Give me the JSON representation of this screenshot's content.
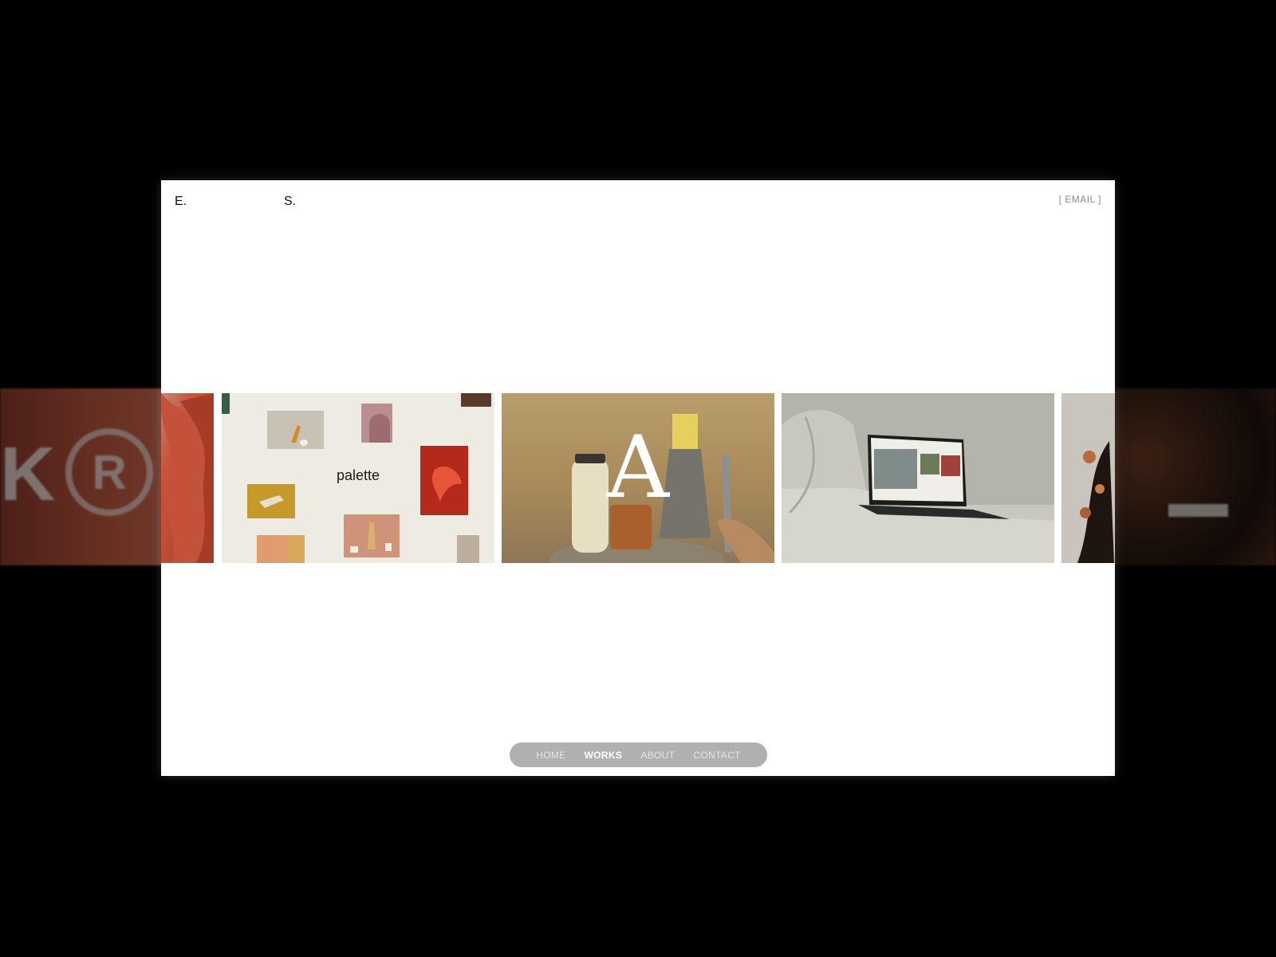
{
  "header": {
    "logo_first": "E.",
    "logo_last": "S.",
    "email_link": "[ EMAIL ]"
  },
  "background_bleed": {
    "left_text": "K",
    "left_symbol": "R"
  },
  "carousel": {
    "cards": [
      {
        "id": "red-sculpture",
        "text": ""
      },
      {
        "id": "palette",
        "text": "palette"
      },
      {
        "id": "kitchen",
        "text": "A"
      },
      {
        "id": "sofa-laptop",
        "text": ""
      },
      {
        "id": "textile",
        "text": ""
      }
    ]
  },
  "nav": {
    "items": [
      {
        "label": "HOME",
        "active": false
      },
      {
        "label": "WORKS",
        "active": true
      },
      {
        "label": "ABOUT",
        "active": false
      },
      {
        "label": "CONTACT",
        "active": false
      }
    ]
  },
  "colors": {
    "page_background": "#000000",
    "window_background": "#ffffff",
    "nav_pill": "#b0b0b0",
    "nav_text": "#e7e7e7",
    "nav_active_text": "#ffffff",
    "palette_card_bg": "#edebe2"
  }
}
